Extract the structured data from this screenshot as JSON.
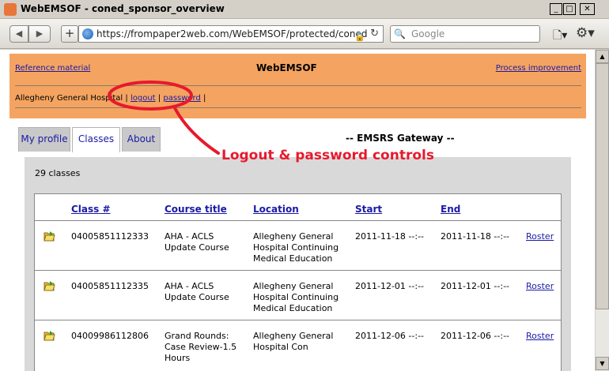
{
  "window": {
    "title": "WebEMSOF - coned_sponsor_overview"
  },
  "browser": {
    "url": "https://frompaper2web.com/WebEMSOF/protected/coned",
    "search_placeholder": "Google",
    "back_glyph": "◀",
    "fwd_glyph": "▶",
    "new_glyph": "+",
    "reload_glyph": "↻",
    "lock_glyph": "🔒",
    "search_glyph": "🔍",
    "page_glyph": "🗋▾",
    "gear_glyph": "⚙▾"
  },
  "header": {
    "reference_link": "Reference material",
    "app_name": "WebEMSOF",
    "process_link": "Process improvement",
    "user": "Allegheny General Hospital",
    "logout": "logout",
    "separator": "|",
    "password": "password"
  },
  "tabs": [
    {
      "label": "My profile"
    },
    {
      "label": "Classes"
    },
    {
      "label": "About"
    }
  ],
  "gateway_title": "-- EMSRS Gateway --",
  "classes": {
    "count": "29 classes",
    "columns": [
      "Class #",
      "Course title",
      "Location",
      "Start",
      "End"
    ],
    "rows": [
      {
        "class_no": "04005851112333",
        "title": "AHA - ACLS Update Course",
        "location": "Allegheny General Hospital Continuing Medical Education",
        "start": "2011-11-18 --:--",
        "end": "2011-11-18 --:--",
        "action": "Roster"
      },
      {
        "class_no": "04005851112335",
        "title": "AHA - ACLS Update Course",
        "location": "Allegheny General Hospital Continuing Medical Education",
        "start": "2011-12-01 --:--",
        "end": "2011-12-01 --:--",
        "action": "Roster"
      },
      {
        "class_no": "04009986112806",
        "title": "Grand Rounds: Case Review-1.5 Hours",
        "location": "Allegheny General Hospital Con",
        "start": "2011-12-06 --:--",
        "end": "2011-12-06 --:--",
        "action": "Roster"
      }
    ]
  },
  "annotation": {
    "text": "Logout & password controls",
    "color": "#e8192c"
  },
  "colors": {
    "header_bg": "#f4a460",
    "link": "#1a1aa6",
    "panel": "#d9d9d9"
  }
}
